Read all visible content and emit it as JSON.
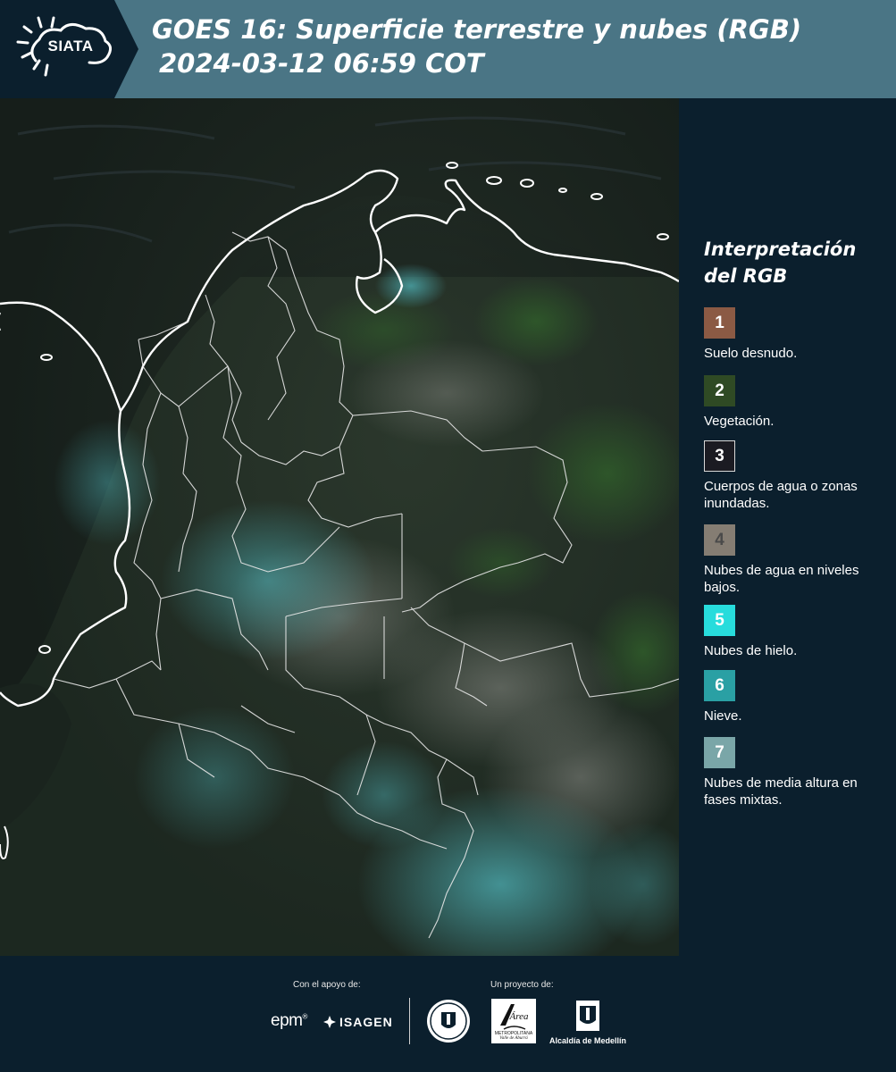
{
  "header": {
    "logo_text": "SIATA",
    "title_line1": "GOES 16: Superficie terrestre y nubes (RGB)",
    "title_line2": "2024-03-12 06:59 COT",
    "background_color": "#4a7585"
  },
  "legend": {
    "title_line1": "Interpretación",
    "title_line2": "del RGB",
    "items": [
      {
        "number": "1",
        "label": "Suelo desnudo.",
        "color": "#8b5a44"
      },
      {
        "number": "2",
        "label": "Vegetación.",
        "color": "#2f4a24"
      },
      {
        "number": "3",
        "label": "Cuerpos de agua o zonas inundadas.",
        "color": "#1b1b22"
      },
      {
        "number": "4",
        "label": "Nubes de agua en niveles bajos.",
        "color": "#857d73"
      },
      {
        "number": "5",
        "label": "Nubes de hielo.",
        "color": "#27dcdc"
      },
      {
        "number": "6",
        "label": "Nieve.",
        "color": "#2aa0a4"
      },
      {
        "number": "7",
        "label": "Nubes de media altura en fases mixtas.",
        "color": "#7aa6a8"
      }
    ]
  },
  "footer": {
    "support_label": "Con el apoyo de:",
    "project_label": "Un proyecto de:",
    "epm_logo_text": "epm",
    "isagen_logo_text": "ISAGEN",
    "amva_line1": "Área",
    "amva_line2": "METROPOLITANA",
    "amva_line3": "Valle de Aburrá",
    "alcaldia_text": "Alcaldía de Medellín"
  },
  "map": {
    "type": "satellite-rgb-composite",
    "region": "Colombia",
    "boundary_color": "#ffffff"
  }
}
